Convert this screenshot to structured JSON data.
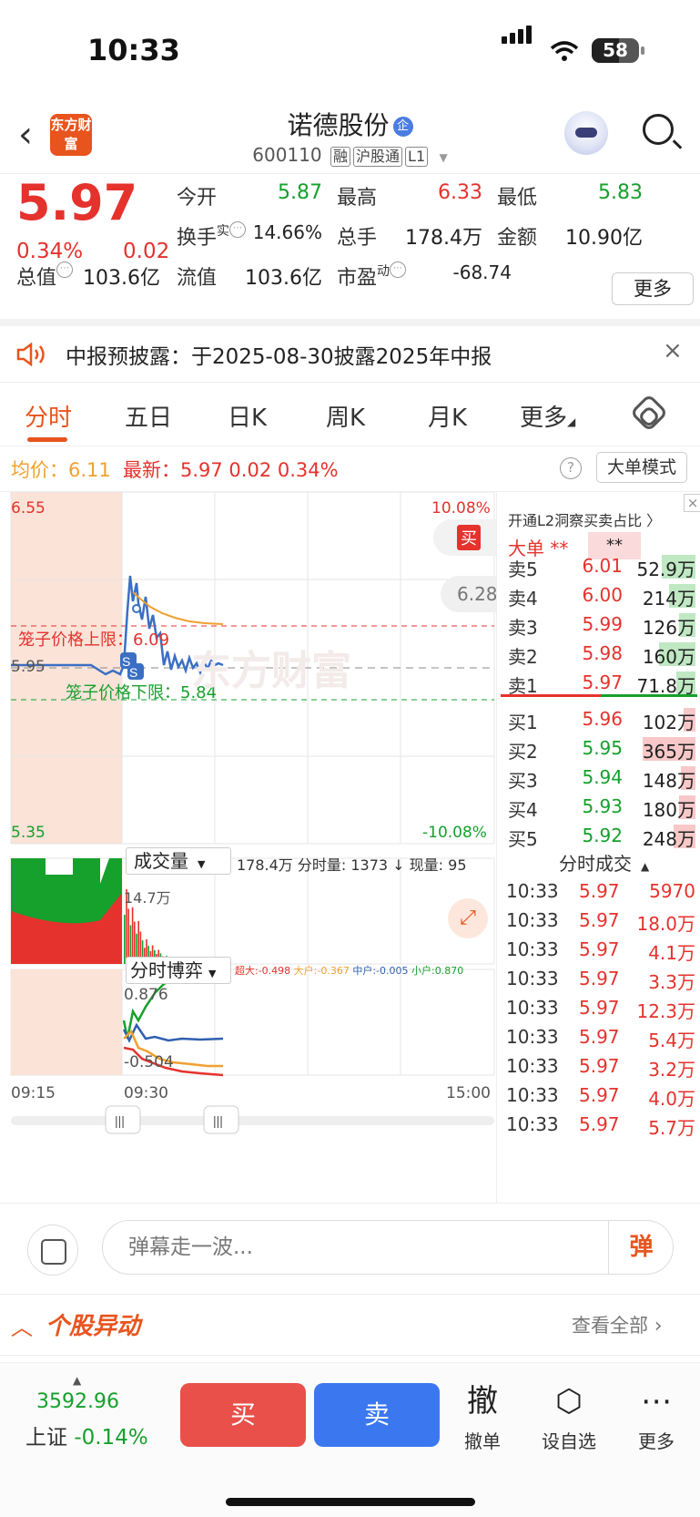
{
  "status": {
    "time": "10:33",
    "battery": "58",
    "battery_level": 0.58
  },
  "nav": {
    "logo": "东方财富",
    "title": "诺德股份",
    "qi_badge": "企",
    "code": "600110",
    "tags": [
      "融",
      "沪股通",
      "L1"
    ]
  },
  "quote": {
    "price": "5.97",
    "pct": "0.34%",
    "chg": "0.02",
    "open_label": "今开",
    "open": "5.87",
    "high_label": "最高",
    "high": "6.33",
    "low_label": "最低",
    "low": "5.83",
    "turnover_label": "换手",
    "turnover_sup": "实",
    "turnover": "14.66%",
    "volume_label": "总手",
    "volume": "178.4万",
    "amount_label": "金额",
    "amount": "10.90亿",
    "mktcap_label": "总值",
    "mktcap": "103.6亿",
    "float_label": "流值",
    "float": "103.6亿",
    "pe_label": "市盈",
    "pe_sup": "动",
    "pe": "-68.74",
    "more": "更多"
  },
  "notice": {
    "text": "中报预披露：于2025-08-30披露2025年中报"
  },
  "tabs": [
    "分时",
    "五日",
    "日K",
    "周K",
    "月K",
    "更多"
  ],
  "avgbar": {
    "avg": "均价：6.11",
    "last": "最新：5.97  0.02  0.34%",
    "mode": "大单模式",
    "help": "?"
  },
  "chart": {
    "y_top": "6.55",
    "y_bottom": "5.35",
    "y_mid": "5.95",
    "pct_top": "10.08%",
    "pct_bottom": "-10.08%",
    "cage_upper": "笼子价格上限：6.09",
    "cage_lower": "笼子价格下限：5.84",
    "buy_tag": "买",
    "bubble": "6.28",
    "watermark": "东方财富",
    "vol_selector": "成交量",
    "vol_info": "178.4万 分时量: 1373 ↓ 现量: 95",
    "vol_peak": "14.7万",
    "game_selector": "分时博弈",
    "game_legend": [
      {
        "label": "超大:-0.498",
        "color": "#e5322d"
      },
      {
        "label": "大户:-0.367",
        "color": "#f0a030"
      },
      {
        "label": "中户:-0.005",
        "color": "#2f5fb0"
      },
      {
        "label": "小户:0.870",
        "color": "#16a02c"
      }
    ],
    "game_top": "0.876",
    "game_bottom": "-0.504",
    "time_start": "09:15",
    "time_open": "09:30",
    "time_end": "15:00",
    "marker": "S"
  },
  "orderbook": {
    "header": "开通L2洞察买卖占比 〉",
    "big_label": "大单",
    "big_stars": "**",
    "big_stars2": "**",
    "asks": [
      {
        "label": "卖5",
        "price": "6.01",
        "vol": "52.9万",
        "color": "#e5322d",
        "share": 0.46
      },
      {
        "label": "卖4",
        "price": "6.00",
        "vol": "214万",
        "color": "#e5322d",
        "share": 0.36
      },
      {
        "label": "卖3",
        "price": "5.99",
        "vol": "126万",
        "color": "#e5322d",
        "share": 0.22
      },
      {
        "label": "卖2",
        "price": "5.98",
        "vol": "160万",
        "color": "#e5322d",
        "share": 0.5
      },
      {
        "label": "卖1",
        "price": "5.97",
        "vol": "71.8万",
        "color": "#e5322d",
        "share": 0.26
      }
    ],
    "bids": [
      {
        "label": "买1",
        "price": "5.96",
        "vol": "102万",
        "color": "#e5322d",
        "share": 0.16
      },
      {
        "label": "买2",
        "price": "5.95",
        "vol": "365万",
        "color": "#16a02c",
        "share": 0.72
      },
      {
        "label": "买3",
        "price": "5.94",
        "vol": "148万",
        "color": "#16a02c",
        "share": 0.2
      },
      {
        "label": "买4",
        "price": "5.93",
        "vol": "180万",
        "color": "#16a02c",
        "share": 0.22
      },
      {
        "label": "买5",
        "price": "5.92",
        "vol": "248万",
        "color": "#16a02c",
        "share": 0.3
      }
    ],
    "ticks_title": "分时成交",
    "ticks": [
      {
        "t": "10:33",
        "p": "5.97",
        "v": "5970"
      },
      {
        "t": "10:33",
        "p": "5.97",
        "v": "18.0万"
      },
      {
        "t": "10:33",
        "p": "5.97",
        "v": "4.1万"
      },
      {
        "t": "10:33",
        "p": "5.97",
        "v": "3.3万"
      },
      {
        "t": "10:33",
        "p": "5.97",
        "v": "12.3万"
      },
      {
        "t": "10:33",
        "p": "5.97",
        "v": "5.4万"
      },
      {
        "t": "10:33",
        "p": "5.97",
        "v": "3.2万"
      },
      {
        "t": "10:33",
        "p": "5.97",
        "v": "4.0万"
      },
      {
        "t": "10:33",
        "p": "5.97",
        "v": "5.7万"
      }
    ]
  },
  "danmu": {
    "placeholder": "弹幕走一波...",
    "send": "弹"
  },
  "movement": {
    "title": "个股异动",
    "view_all": "查看全部"
  },
  "bottom": {
    "index_value": "3592.96",
    "index_name": "上证",
    "index_pct": "-0.14%",
    "buy": "买",
    "sell": "卖",
    "cancel_icon": "撤",
    "cancel": "撤单",
    "watch": "设自选",
    "more": "更多"
  }
}
